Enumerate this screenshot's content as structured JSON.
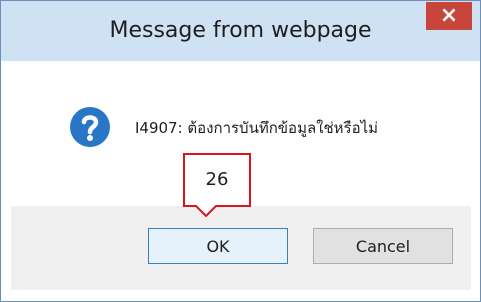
{
  "dialog": {
    "title": "Message from webpage",
    "close_label": "×",
    "message": "I4907: ต้องการบันทึกข้อมูลใช่หรือไม่",
    "icon": "question-icon"
  },
  "buttons": {
    "ok_label": "OK",
    "cancel_label": "Cancel"
  },
  "annotation": {
    "step_number": "26",
    "color": "#d9141c"
  },
  "colors": {
    "titlebar": "#cfe2f4",
    "close": "#c7453a",
    "icon": "#2a76c6"
  }
}
